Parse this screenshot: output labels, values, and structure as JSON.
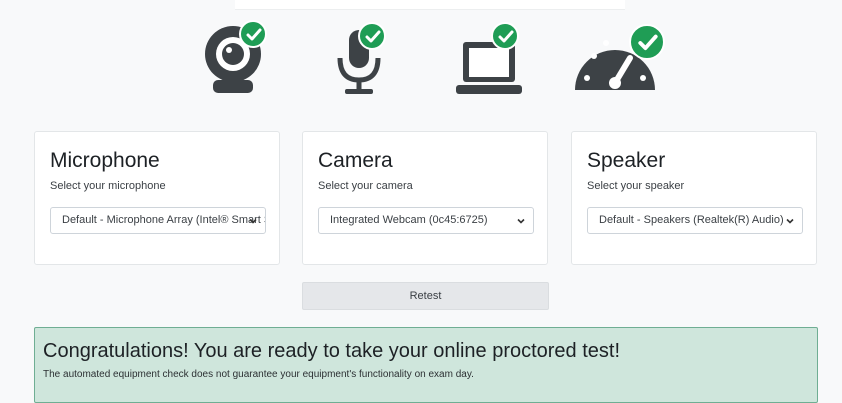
{
  "devices": [
    {
      "icon": "webcam-icon"
    },
    {
      "icon": "microphone-icon"
    },
    {
      "icon": "laptop-icon"
    },
    {
      "icon": "speedometer-icon"
    }
  ],
  "cards": {
    "microphone": {
      "title": "Microphone",
      "hint": "Select your microphone",
      "selected": "Default - Microphone Array (Intel® Smart Sound"
    },
    "camera": {
      "title": "Camera",
      "hint": "Select your camera",
      "selected": "Integrated Webcam (0c45:6725)"
    },
    "speaker": {
      "title": "Speaker",
      "hint": "Select your speaker",
      "selected": "Default - Speakers (Realtek(R) Audio)"
    }
  },
  "retest_label": "Retest",
  "alert": {
    "heading": "Congratulations! You are ready to take your online proctored test!",
    "note": "The automated equipment check does not guarantee your equipment's functionality on exam day."
  },
  "colors": {
    "icon": "#3d4246",
    "check": "#1f9d55",
    "alert_bg": "#cfe6dc",
    "alert_border": "#6fae93"
  }
}
